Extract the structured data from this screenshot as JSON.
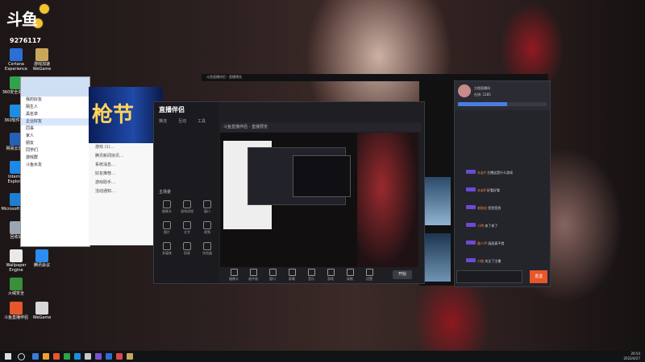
{
  "stream_overlay": {
    "logo": "斗鱼",
    "room_id": "9276117"
  },
  "desktop_icons": [
    {
      "label": "Cortana Experience",
      "color": "#2b6fd6"
    },
    {
      "label": "360安全浏览器",
      "color": "#2fa24a"
    },
    {
      "label": "游戏加速 WeGame",
      "color": "#c8a65a"
    },
    {
      "label": "360软件管家",
      "color": "#1d8de0"
    },
    {
      "label": "网易云",
      "color": "#c82e2e"
    },
    {
      "label": "网易云音乐",
      "color": "#2460b8"
    },
    {
      "label": "Internet Explorer",
      "color": "#1e88e5"
    },
    {
      "label": "Microsoft Edge",
      "color": "#1c7fd1"
    },
    {
      "label": "回收站",
      "color": "#9aa7b3"
    },
    {
      "label": "Wallpaper Engine",
      "color": "#e9e9e9"
    },
    {
      "label": "腾讯会议",
      "color": "#2a8df0"
    },
    {
      "label": "火绒安全",
      "color": "#3a8f3a"
    },
    {
      "label": "斗鱼直播伴侣",
      "color": "#e8562a"
    },
    {
      "label": "WeGame",
      "color": "#d8d8d8"
    }
  ],
  "chat_window": {
    "items": [
      "我的好友",
      "陌生人",
      "黑名单",
      "企业好友",
      "同事",
      "家人",
      "朋友",
      "同学们",
      "游戏群",
      "斗鱼水友"
    ]
  },
  "message_window": {
    "banner": "枪节",
    "messages": [
      "游戏 (1)…",
      "腾讯新闻快讯…",
      "系统消息…",
      "好友推荐…",
      "游戏助手…",
      "活动通知…"
    ]
  },
  "live_companion": {
    "logo": "直播伴侣",
    "tabs": [
      "推流",
      "互动",
      "工具"
    ],
    "scene_label": "主场景",
    "preview_title": "斗鱼直播伴侣 - 直播预览",
    "left_tools": [
      "摄像头",
      "游戏进程",
      "窗口",
      "图片",
      "文字",
      "视频",
      "多媒体",
      "投屏",
      "浏览器"
    ],
    "bottom_tools": [
      "摄像头",
      "画中画",
      "窗口",
      "屏幕",
      "音乐",
      "游戏",
      "录制",
      "设置"
    ],
    "start_button": "开始"
  },
  "danmaku_panel": {
    "streamer": "大橙直播间",
    "viewers": "在线: 1285",
    "messages": [
      {
        "user": "水友A",
        "text": "主播这是什么游戏"
      },
      {
        "user": "水友B",
        "text": "好看好看"
      },
      {
        "user": "老粉丝",
        "text": "签到签到"
      },
      {
        "user": "小明",
        "text": "来了来了"
      },
      {
        "user": "路人甲",
        "text": "画面真不错"
      },
      {
        "user": "小橙",
        "text": "关注了主播"
      },
      {
        "user": "游客",
        "text": "多开几个窗口"
      },
      {
        "user": "铁粉",
        "text": "主播加油"
      }
    ],
    "send_label": "发送"
  },
  "taskbar": {
    "time": "20:54",
    "date": "2022/4/27"
  }
}
